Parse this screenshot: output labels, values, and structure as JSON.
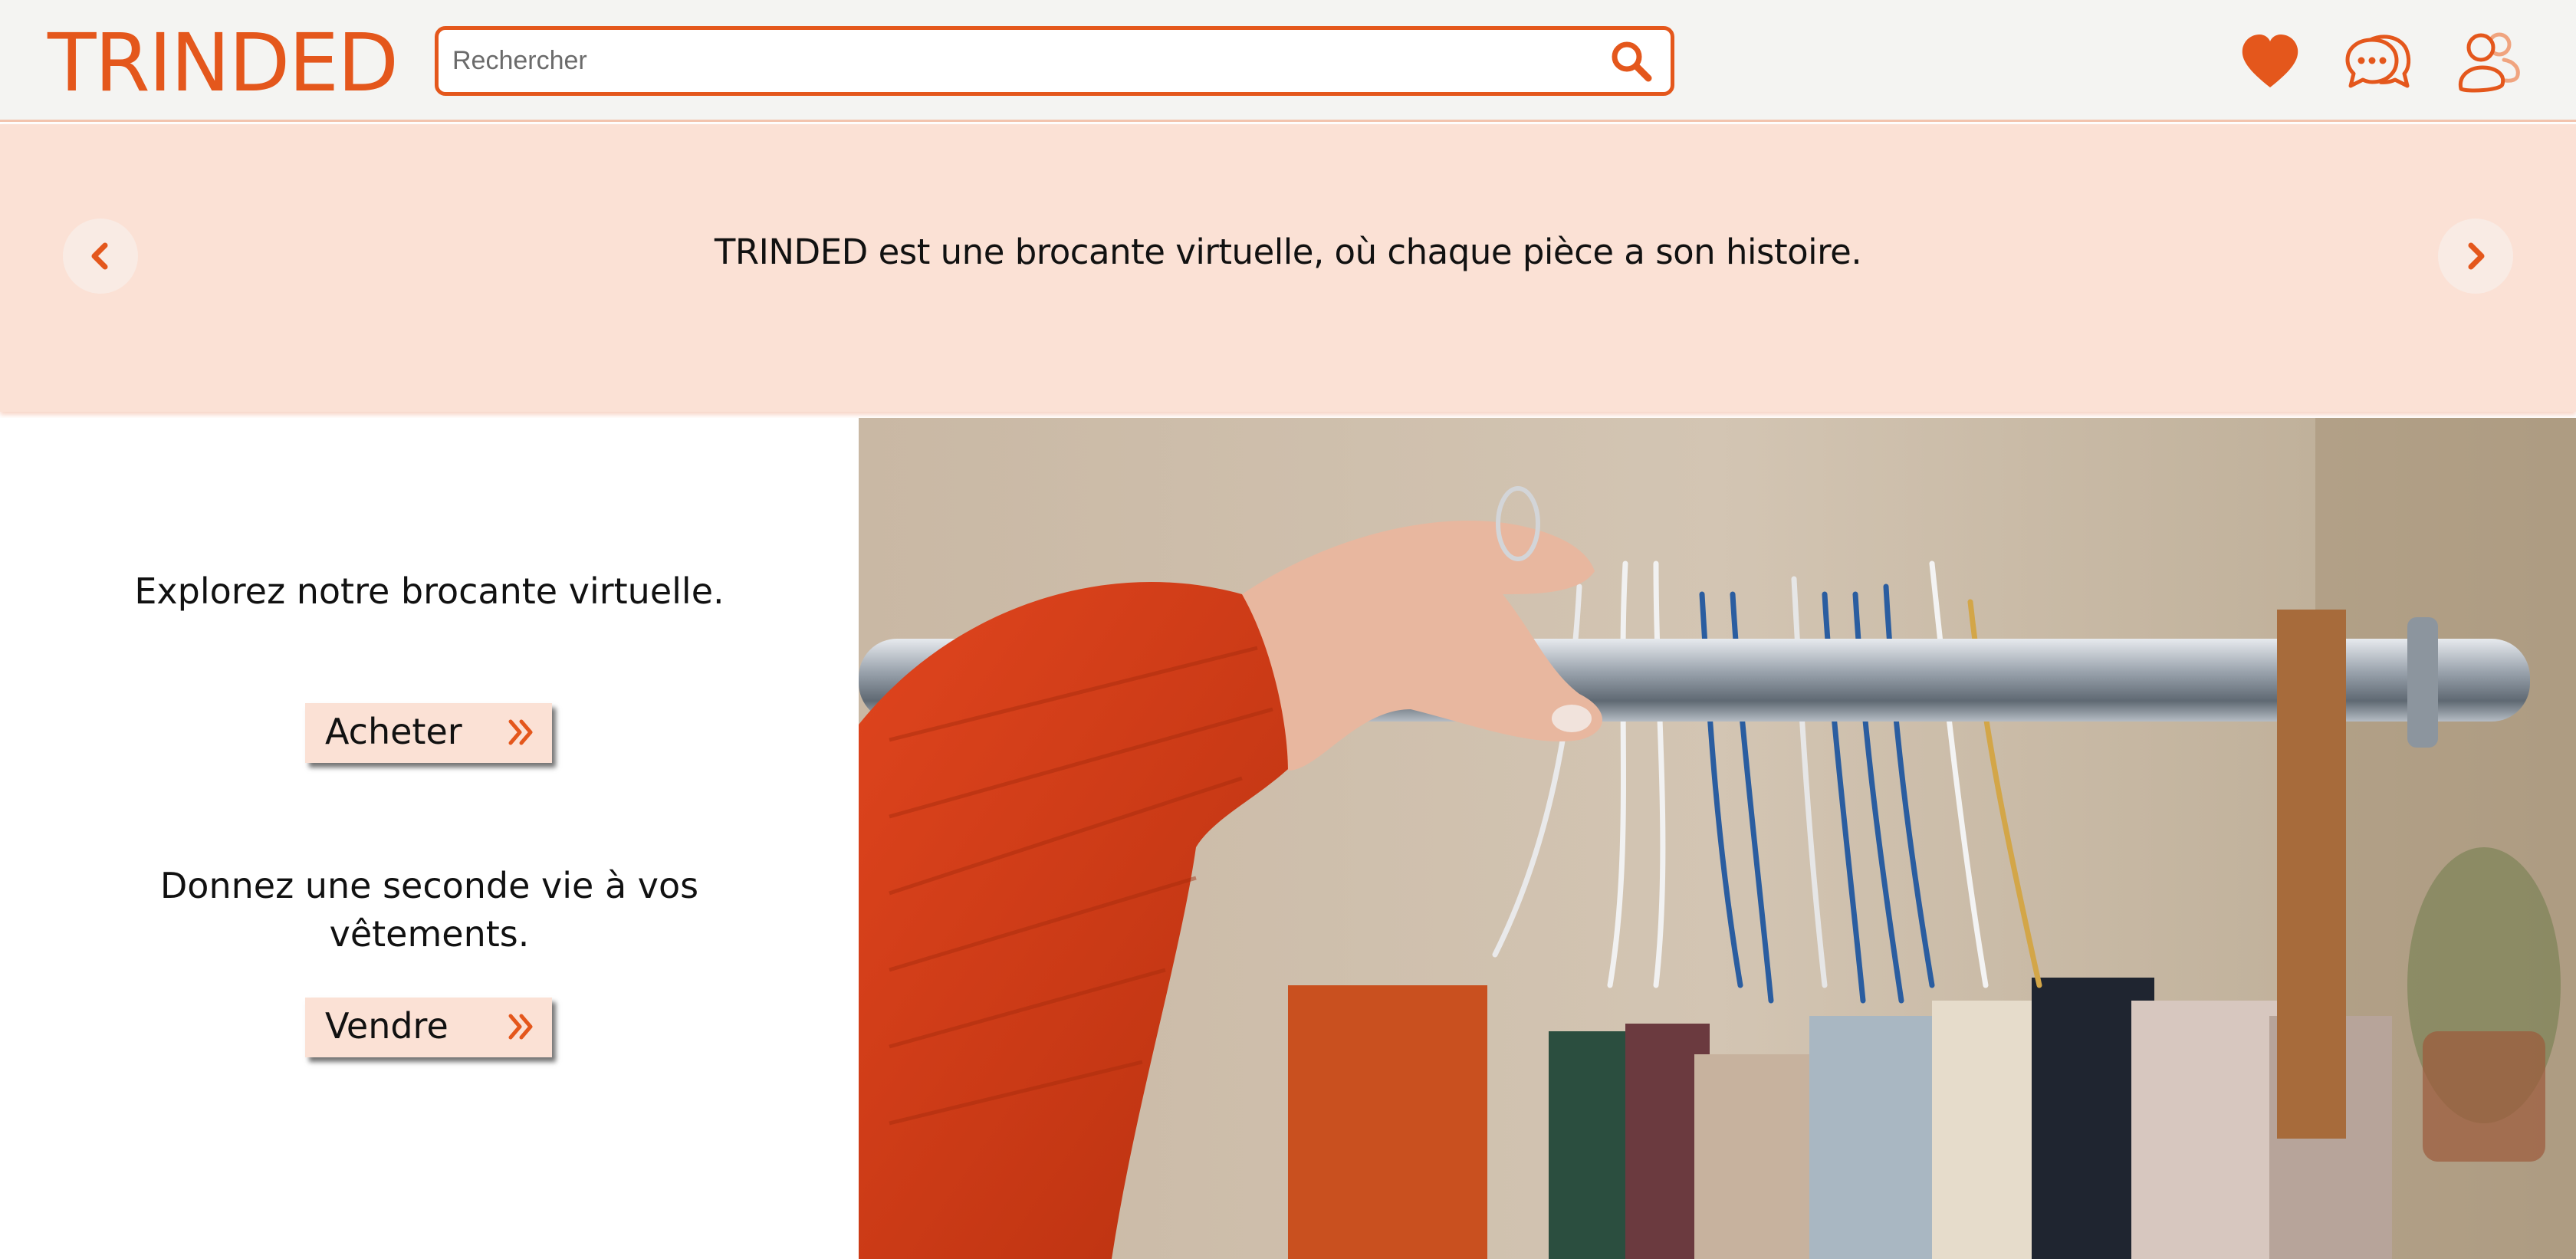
{
  "header": {
    "logo": "TRINDED",
    "search_placeholder": "Rechercher",
    "icons": [
      "heart-icon",
      "chat-icon",
      "users-icon"
    ]
  },
  "banner": {
    "text": "TRINDED est une brocante virtuelle, où chaque pièce a son histoire.",
    "prev_icon": "chevron-left-icon",
    "next_icon": "chevron-right-icon"
  },
  "cta": [
    {
      "title": "Explorez notre brocante virtuelle.",
      "button": "Acheter"
    },
    {
      "title": "Donnez une seconde vie à vos vêtements.",
      "button": "Vendre"
    }
  ],
  "hero_image": "clothing-rack-photo",
  "colors": {
    "accent": "#e4571c",
    "banner_bg": "#fbe1d5",
    "header_bg": "#f4f4f2"
  }
}
